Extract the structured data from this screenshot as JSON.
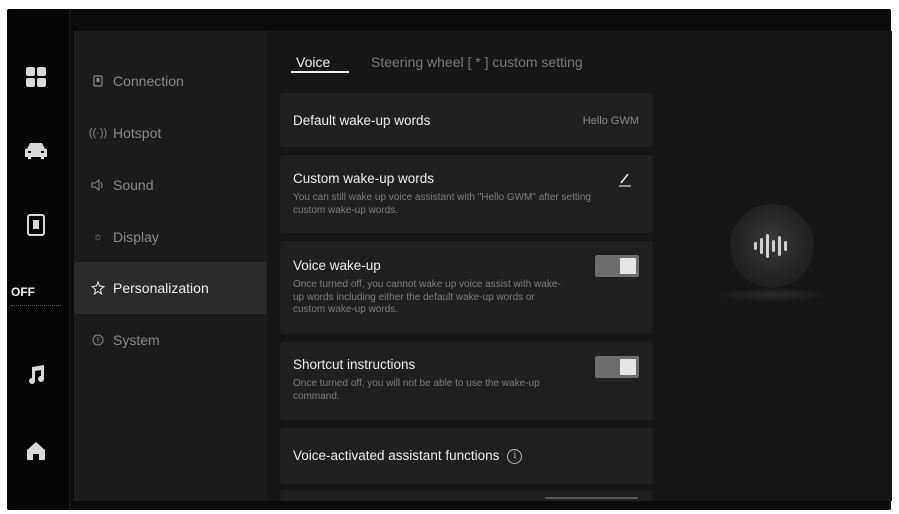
{
  "sidebar_status": {
    "off_label": "OFF"
  },
  "nav": {
    "items": [
      {
        "label": "Connection",
        "icon": "connection-icon"
      },
      {
        "label": "Hotspot",
        "icon": "hotspot-icon"
      },
      {
        "label": "Sound",
        "icon": "sound-icon"
      },
      {
        "label": "Display",
        "icon": "display-icon"
      },
      {
        "label": "Personalization",
        "icon": "personalization-icon"
      },
      {
        "label": "System",
        "icon": "system-icon"
      }
    ],
    "active": "Personalization"
  },
  "tabs": {
    "voice": "Voice",
    "steering": "Steering wheel [ * ] custom setting"
  },
  "settings": {
    "default_wake": {
      "title": "Default wake-up words",
      "value": "Hello GWM"
    },
    "custom_wake": {
      "title": "Custom wake-up words",
      "desc": "You can still wake up voice assistant with \"Hello GWM\" after setting custom wake-up words."
    },
    "voice_wake": {
      "title": "Voice wake-up",
      "desc": "Once turned off, you cannot wake up voice assist with wake-up words including either the default wake-up words or custom wake-up words.",
      "enabled": true
    },
    "shortcut": {
      "title": "Shortcut instructions",
      "desc": "Once turned off, you will not be able to use the wake-up command.",
      "enabled": true
    },
    "functions": {
      "title": "Voice-activated assistant functions"
    }
  },
  "colors": {
    "background": "#0b0b0b",
    "card": "#1f1f1f",
    "toggle_on": "#6e6e6e"
  }
}
